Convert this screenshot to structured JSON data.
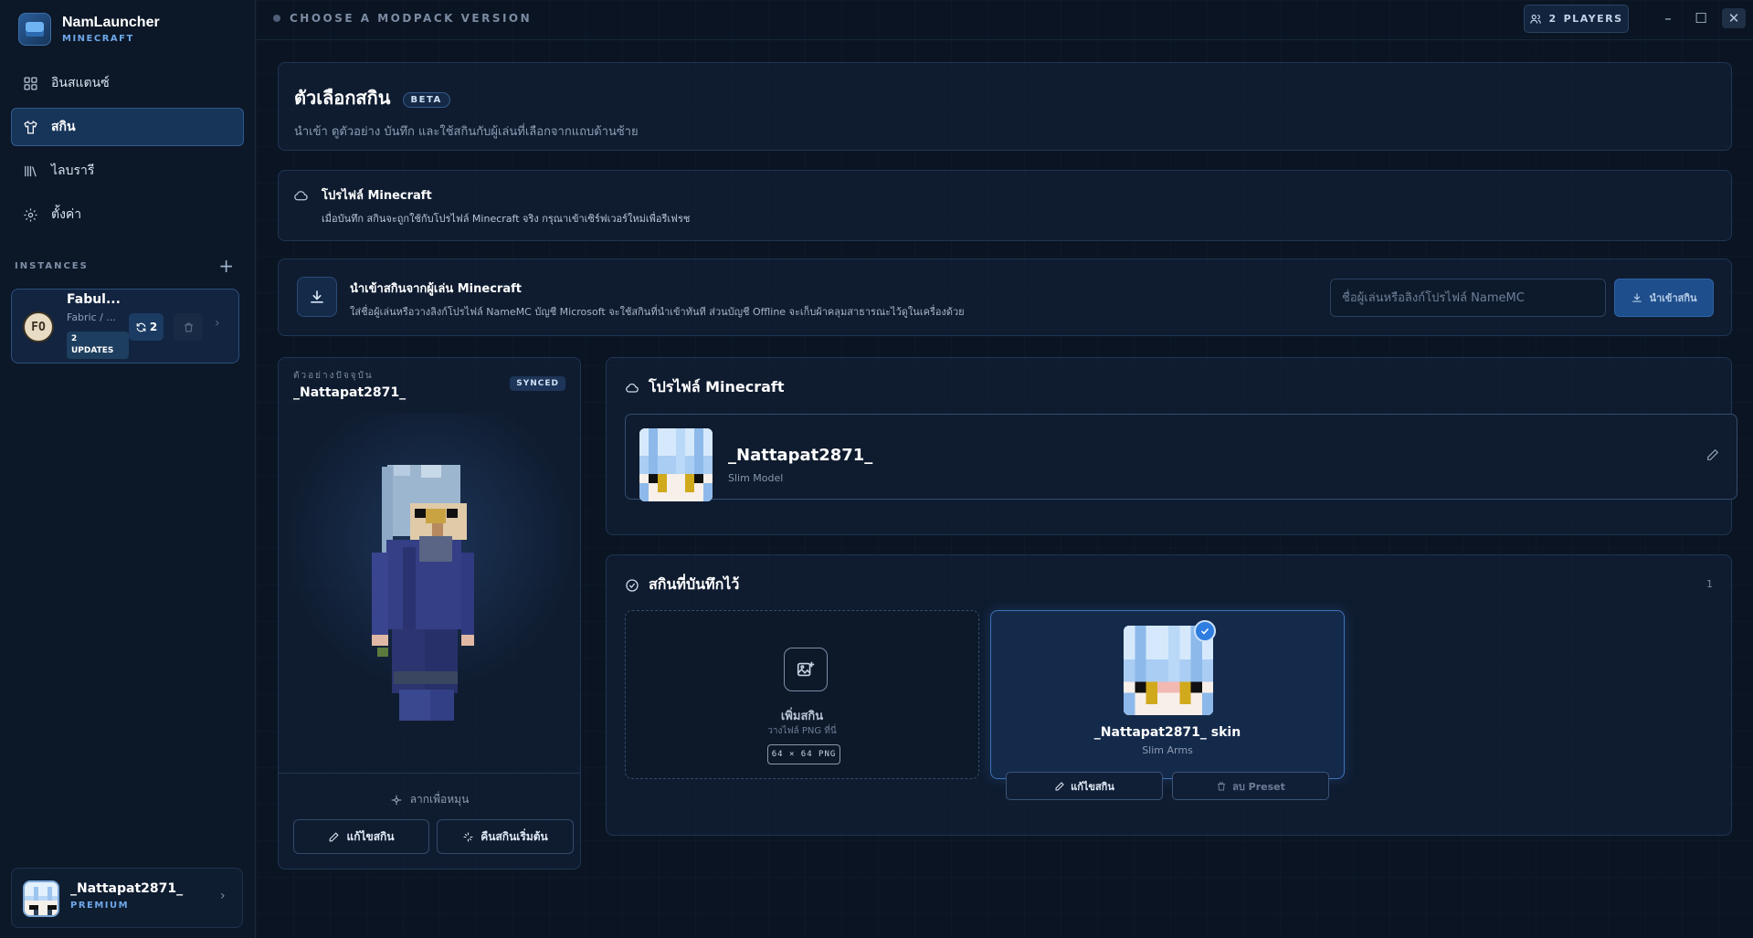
{
  "brand": {
    "name": "NamLauncher",
    "sub": "MINECRAFT"
  },
  "nav": [
    {
      "label": "อินสแตนซ์",
      "icon": "grid-icon",
      "active": false
    },
    {
      "label": "สกิน",
      "icon": "shirt-icon",
      "active": true
    },
    {
      "label": "ไลบรารี",
      "icon": "library-icon",
      "active": false
    },
    {
      "label": "ตั้งค่า",
      "icon": "gear-icon",
      "active": false
    }
  ],
  "instances": {
    "title": "INSTANCES",
    "item": {
      "avatar_text": "FO",
      "name": "Fabul...",
      "meta": "Fabric / ...",
      "updates_count": "2",
      "updates_label": "UPDATES",
      "sync_count": "2"
    }
  },
  "user": {
    "name": "_Nattapat2871_",
    "tier": "PREMIUM"
  },
  "topbar": {
    "crumb": "CHOOSE A MODPACK VERSION",
    "players_count": "2",
    "players_label": "PLAYERS"
  },
  "header": {
    "title": "ตัวเลือกสกิน",
    "badge": "BETA",
    "subtitle": "นำเข้า ดูตัวอย่าง บันทึก และใช้สกินกับผู้เล่นที่เลือกจากแถบด้านซ้าย"
  },
  "profile_banner": {
    "title": "โปรไฟล์ Minecraft",
    "text": "เมื่อบันทึก สกินจะถูกใช้กับโปรไฟล์ Minecraft จริง กรุณาเข้าเซิร์ฟเวอร์ใหม่เพื่อรีเฟรช"
  },
  "import": {
    "title": "นำเข้าสกินจากผู้เล่น Minecraft",
    "text": "ใส่ชื่อผู้เล่นหรือวางลิงก์โปรไฟล์ NameMC บัญชี Microsoft จะใช้สกินที่นำเข้าทันที ส่วนบัญชี Offline จะเก็บผ้าคลุมสาธารณะไว้ดูในเครื่องด้วย",
    "placeholder": "ชื่อผู้เล่นหรือลิงก์โปรไฟล์ NameMC",
    "button": "นำเข้าสกิน"
  },
  "preview": {
    "label": "ตัวอย่างปัจจุบัน",
    "name": "_Nattapat2871_",
    "status": "SYNCED",
    "drag_hint": "ลากเพื่อหมุน",
    "edit_button": "แก้ไขสกิน",
    "reset_button": "คืนสกินเริ่มต้น"
  },
  "mc_profile": {
    "title": "โปรไฟล์ Minecraft",
    "name": "_Nattapat2871_",
    "model": "Slim Model"
  },
  "saved": {
    "title": "สกินที่บันทึกไว้",
    "count": "1",
    "add": {
      "label": "เพิ่มสกิน",
      "hint": "วางไฟล์ PNG ที่นี่",
      "size": "64 × 64 PNG"
    },
    "skin": {
      "name": "_Nattapat2871_ skin",
      "model": "Slim Arms",
      "edit": "แก้ไขสกิน",
      "delete": "ลบ Preset"
    }
  },
  "colors": {
    "accent": "#2e7de0",
    "background": "#0a1422",
    "sidebar": "#0c1727",
    "active_nav": "#173459"
  }
}
